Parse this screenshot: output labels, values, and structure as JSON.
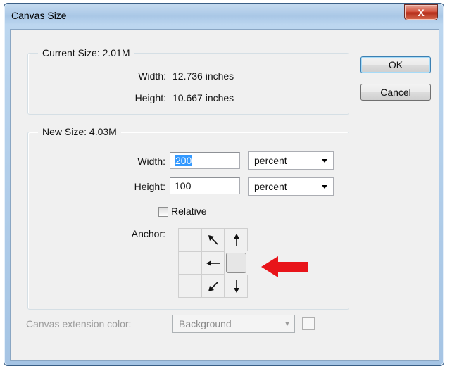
{
  "window": {
    "title": "Canvas Size",
    "close_label": "X"
  },
  "current_size": {
    "legend": "Current Size: 2.01M",
    "width_label": "Width:",
    "width_value": "12.736 inches",
    "height_label": "Height:",
    "height_value": "10.667 inches"
  },
  "new_size": {
    "legend": "New Size: 4.03M",
    "width_label": "Width:",
    "width_value": "200",
    "width_unit": "percent",
    "height_label": "Height:",
    "height_value": "100",
    "height_unit": "percent",
    "relative_label": "Relative",
    "relative_checked": false,
    "anchor_label": "Anchor:",
    "anchor_selected": "middle-right"
  },
  "buttons": {
    "ok": "OK",
    "cancel": "Cancel"
  },
  "extension": {
    "label": "Canvas extension color:",
    "value": "Background"
  },
  "colors": {
    "highlight_arrow": "#e8141a",
    "selection": "#3399ff"
  },
  "icons": {
    "anchor_top_middle": "arrow-up-left-icon",
    "anchor_top_right": "arrow-up-icon",
    "anchor_middle_middle": "arrow-left-icon",
    "anchor_bottom_middle": "arrow-down-left-icon",
    "anchor_bottom_right": "arrow-down-icon",
    "annotation": "red-arrow-left-icon"
  }
}
